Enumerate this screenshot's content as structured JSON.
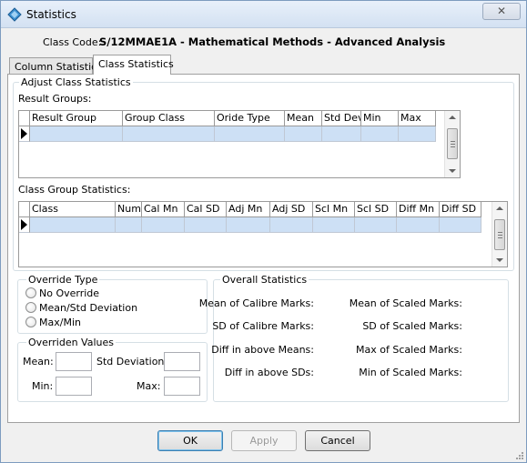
{
  "window": {
    "title": "Statistics",
    "close_glyph": "✕"
  },
  "class_code": {
    "label": "Class Code:",
    "value": "S/12MMAE1A - Mathematical Methods - Advanced Analysis"
  },
  "tabs": [
    {
      "label": "Column Statistics",
      "active": false
    },
    {
      "label": "Class Statistics",
      "active": true
    }
  ],
  "adjust": {
    "legend": "Adjust Class Statistics",
    "result_groups": {
      "label": "Result Groups:",
      "columns": [
        "Result Group",
        "Group Class",
        "Oride Type",
        "Mean",
        "Std Dev",
        "Min",
        "Max"
      ]
    },
    "class_group_statistics": {
      "label": "Class Group Statistics:",
      "columns": [
        "Class",
        "Num",
        "Cal Mn",
        "Cal SD",
        "Adj Mn",
        "Adj SD",
        "Scl Mn",
        "Scl SD",
        "Diff Mn",
        "Diff SD"
      ]
    }
  },
  "override_type": {
    "legend": "Override Type",
    "options": [
      "No Override",
      "Mean/Std Deviation",
      "Max/Min"
    ]
  },
  "overriden_values": {
    "legend": "Overriden Values",
    "mean": "Mean:",
    "std_deviation": "Std Deviation:",
    "min": "Min:",
    "max": "Max:"
  },
  "overall_statistics": {
    "legend": "Overall Statistics",
    "mean_calibre": "Mean of Calibre Marks:",
    "sd_calibre": "SD of Calibre Marks:",
    "diff_means": "Diff in above Means:",
    "diff_sds": "Diff in above SDs:",
    "mean_scaled": "Mean of Scaled Marks:",
    "sd_scaled": "SD of Scaled Marks:",
    "max_scaled": "Max of Scaled Marks:",
    "min_scaled": "Min of Scaled Marks:"
  },
  "buttons": {
    "ok": "OK",
    "apply": "Apply",
    "cancel": "Cancel"
  },
  "colors": {
    "selected_row": "#cde0f5",
    "title_bar": "#d3e1f2",
    "default_button_border": "#3c7fb1"
  }
}
